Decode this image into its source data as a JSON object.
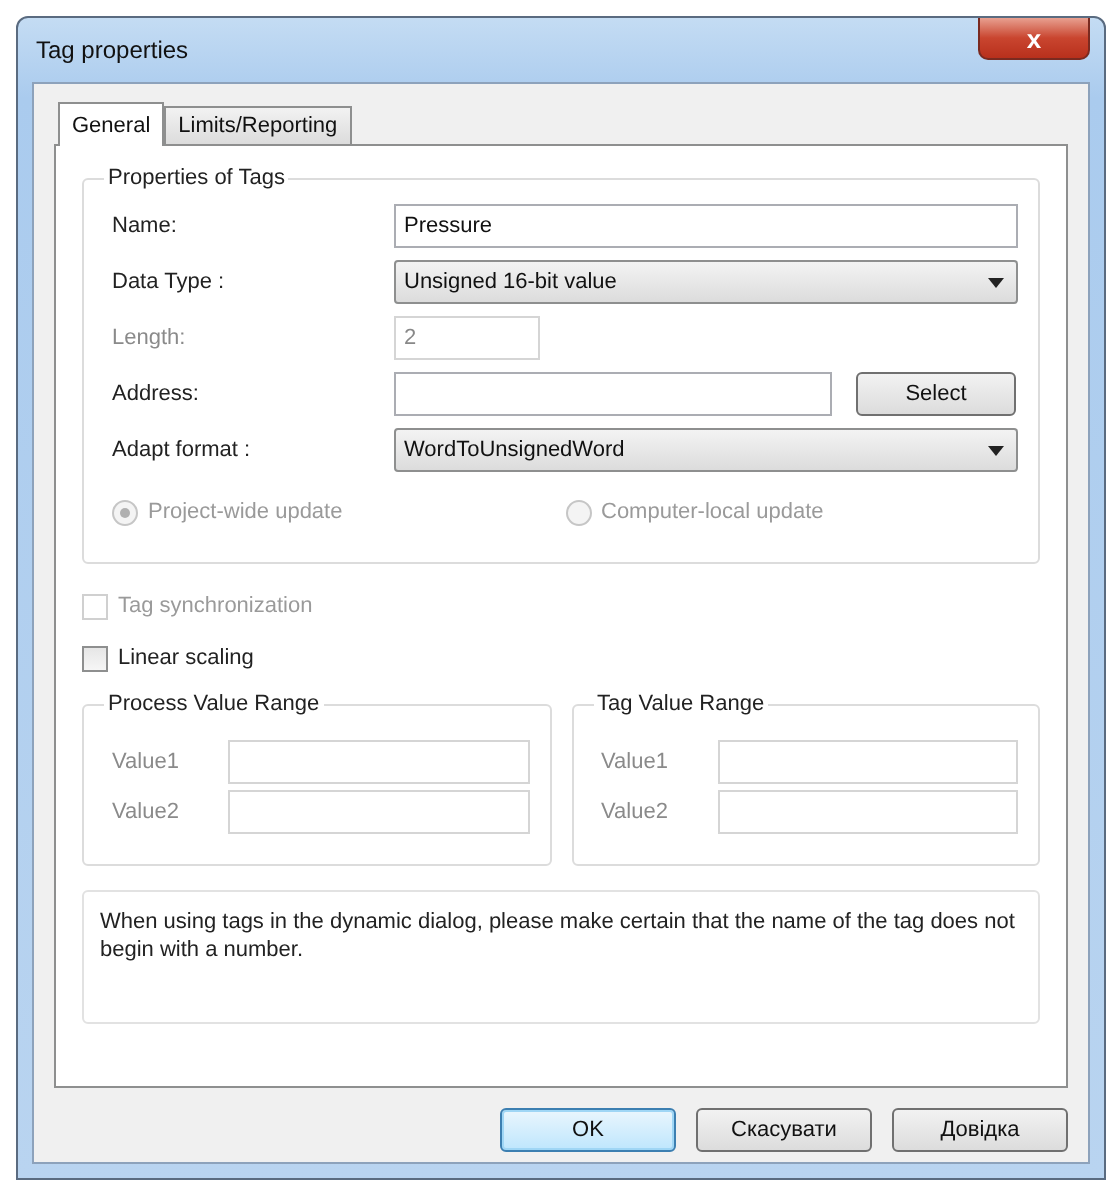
{
  "window": {
    "title": "Tag properties",
    "close": "x"
  },
  "tabs": [
    {
      "label": "General",
      "selected": true
    },
    {
      "label": "Limits/Reporting",
      "selected": false
    }
  ],
  "properties_group": {
    "title": "Properties of Tags",
    "fields": [
      {
        "kind": "text",
        "label": "Name:",
        "value": "Pressure",
        "disabled": false
      },
      {
        "kind": "dropdown",
        "label": "Data Type :",
        "value": "Unsigned 16-bit value",
        "disabled": false
      },
      {
        "kind": "short",
        "label": "Length:",
        "value": "2",
        "disabled": true
      },
      {
        "kind": "button",
        "label": "Address:",
        "button": "Select",
        "disabled": false
      },
      {
        "kind": "dropdown",
        "label": "Adapt format :",
        "value": "WordToUnsignedWord",
        "disabled": false
      }
    ],
    "update_options": [
      {
        "label": "Project-wide update",
        "selected": true,
        "disabled": true
      },
      {
        "label": "Computer-local update",
        "selected": false,
        "disabled": true
      }
    ]
  },
  "checkboxes": [
    {
      "label": "Tag synchronization",
      "checked": false,
      "disabled": true
    },
    {
      "label": "Linear scaling",
      "checked": false,
      "disabled": false
    }
  ],
  "ranges": [
    {
      "title": "Process Value Range",
      "rows": [
        {
          "label": "Value1"
        },
        {
          "label": "Value2"
        }
      ]
    },
    {
      "title": "Tag Value Range",
      "rows": [
        {
          "label": "Value1"
        },
        {
          "label": "Value2"
        }
      ]
    }
  ],
  "info": "When using tags in the dynamic dialog, please make certain that the name of the tag does not begin with a number.",
  "buttons": [
    {
      "label": "OK",
      "default": true
    },
    {
      "label": "Скасувати",
      "default": false
    },
    {
      "label": "Довідка",
      "default": false
    }
  ]
}
